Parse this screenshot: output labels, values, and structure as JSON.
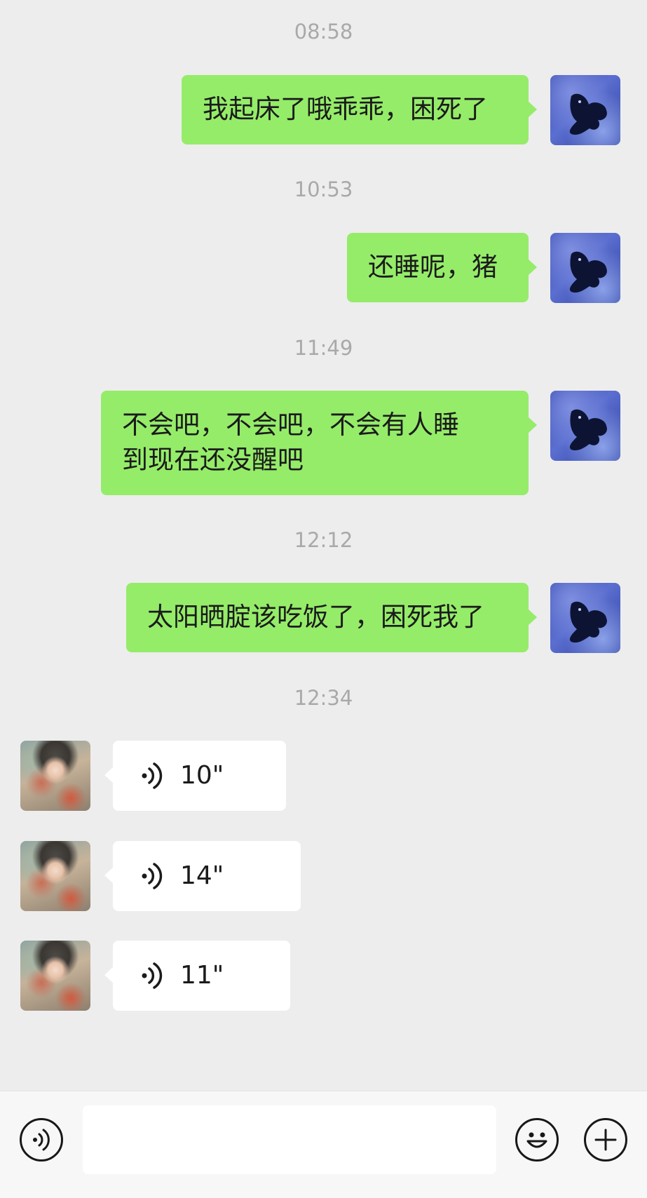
{
  "messages": [
    {
      "timestamp": "08:58",
      "direction": "out",
      "text": "我起床了哦乖乖，困死了"
    },
    {
      "timestamp": "10:53",
      "direction": "out",
      "text": "还睡呢，猪"
    },
    {
      "timestamp": "11:49",
      "direction": "out",
      "text": "不会吧，不会吧，不会有人睡\n到现在还没醒吧"
    },
    {
      "timestamp": "12:12",
      "direction": "out",
      "text": "太阳晒腚该吃饭了，困死我了"
    }
  ],
  "voice_timestamp": "12:34",
  "voice_messages": [
    {
      "duration": "10\""
    },
    {
      "duration": "14\""
    },
    {
      "duration": "11\""
    }
  ],
  "input": {
    "value": "",
    "placeholder": ""
  },
  "bottom_icons": [
    "voice-icon",
    "emoji-icon",
    "plus-icon"
  ],
  "colors": {
    "background": "#ededed",
    "outgoing_bubble": "#95ec69",
    "incoming_bubble": "#ffffff",
    "timestamp_text": "#a9a9a9",
    "toolbar": "#f7f7f7"
  }
}
